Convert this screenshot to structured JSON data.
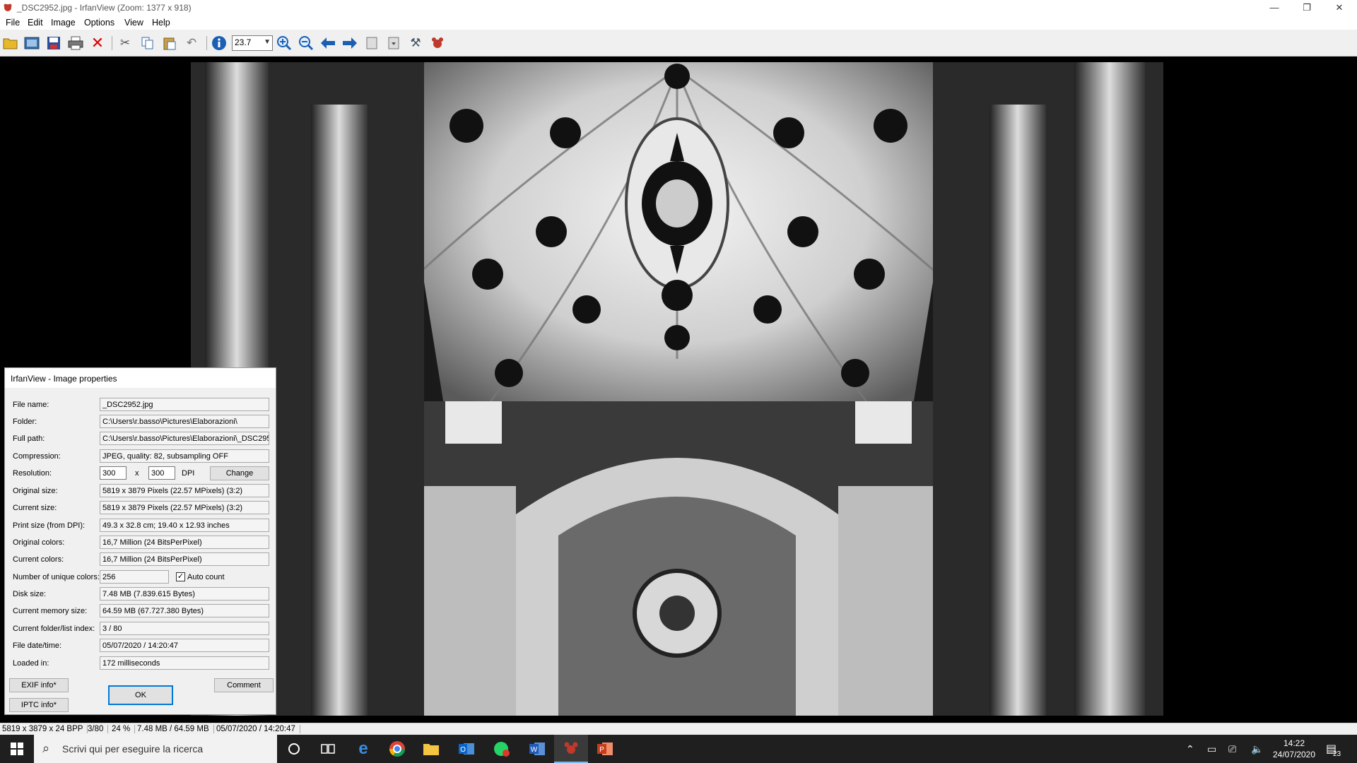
{
  "window": {
    "title": "_DSC2952.jpg - IrfanView (Zoom: 1377 x 918)",
    "controls": {
      "minimize": "—",
      "restore": "❐",
      "close": "✕"
    }
  },
  "menu": [
    "File",
    "Edit",
    "Image",
    "Options",
    "View",
    "Help"
  ],
  "toolbar": {
    "zoom_value": "23.7",
    "icons": [
      "open-folder-icon",
      "slideshow-icon",
      "save-icon",
      "print-icon",
      "delete-icon",
      "cut-icon",
      "copy-icon",
      "paste-icon",
      "undo-icon",
      "info-icon",
      "zoom-in-icon",
      "zoom-out-icon",
      "previous-icon",
      "next-icon",
      "copy-to-icon",
      "move-to-icon",
      "settings-icon",
      "irfanview-logo-icon"
    ]
  },
  "dialog": {
    "title": "IrfanView - Image properties",
    "rows": [
      {
        "label": "File name:",
        "value": "_DSC2952.jpg"
      },
      {
        "label": "Folder:",
        "value": "C:\\Users\\r.basso\\Pictures\\Elaborazioni\\"
      },
      {
        "label": "Full path:",
        "value": "C:\\Users\\r.basso\\Pictures\\Elaborazioni\\_DSC295"
      },
      {
        "label": "Compression:",
        "value": "JPEG, quality: 82, subsampling OFF"
      },
      {
        "label": "Resolution:",
        "value": ""
      },
      {
        "label": "Original size:",
        "value": "5819 x 3879  Pixels (22.57 MPixels) (3:2)"
      },
      {
        "label": "Current size:",
        "value": "5819 x 3879  Pixels (22.57 MPixels) (3:2)"
      },
      {
        "label": "Print size (from DPI):",
        "value": "49.3 x 32.8 cm; 19.40 x 12.93 inches"
      },
      {
        "label": "Original colors:",
        "value": "16,7 Million   (24 BitsPerPixel)"
      },
      {
        "label": "Current colors:",
        "value": "16,7 Million   (24 BitsPerPixel)"
      },
      {
        "label": "Number of unique colors:",
        "value": ""
      },
      {
        "label": "Disk size:",
        "value": "7.48 MB (7.839.615 Bytes)"
      },
      {
        "label": "Current memory size:",
        "value": "64.59  MB (67.727.380 Bytes)"
      },
      {
        "label": "Current folder/list index:",
        "value": "3  /  80"
      },
      {
        "label": "File date/time:",
        "value": "05/07/2020 / 14:20:47"
      },
      {
        "label": "Loaded in:",
        "value": "172 milliseconds"
      }
    ],
    "resolution_x": "300",
    "resolution_sep": "x",
    "resolution_y": "300",
    "resolution_unit": "DPI",
    "change_label": "Change",
    "unique_colors": "256",
    "auto_count_label": "Auto count",
    "auto_count_checked": "✓",
    "exif_label": "EXIF info*",
    "iptc_label": "IPTC info*",
    "ok_label": "OK",
    "comment_label": "Comment"
  },
  "status": [
    "5819 x 3879 x 24 BPP",
    "3/80",
    "24 %",
    "7.48 MB / 64.59 MB",
    "05/07/2020 / 14:20:47"
  ],
  "taskbar": {
    "search_placeholder": "Scrivi qui per eseguire la ricerca",
    "time": "14:22",
    "date": "24/07/2020",
    "notification_count": "23"
  }
}
